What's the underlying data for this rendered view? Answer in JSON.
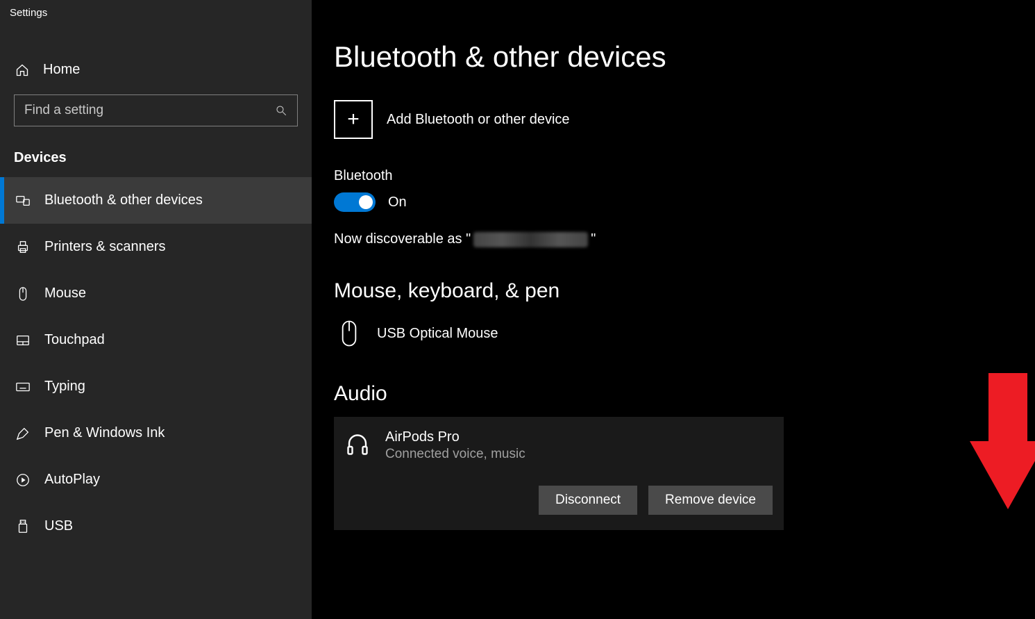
{
  "window_title": "Settings",
  "sidebar": {
    "home_label": "Home",
    "search_placeholder": "Find a setting",
    "section_label": "Devices",
    "items": [
      {
        "label": "Bluetooth & other devices",
        "icon": "bluetooth-devices-icon",
        "selected": true
      },
      {
        "label": "Printers & scanners",
        "icon": "printer-icon",
        "selected": false
      },
      {
        "label": "Mouse",
        "icon": "mouse-icon",
        "selected": false
      },
      {
        "label": "Touchpad",
        "icon": "touchpad-icon",
        "selected": false
      },
      {
        "label": "Typing",
        "icon": "keyboard-icon",
        "selected": false
      },
      {
        "label": "Pen & Windows Ink",
        "icon": "pen-icon",
        "selected": false
      },
      {
        "label": "AutoPlay",
        "icon": "autoplay-icon",
        "selected": false
      },
      {
        "label": "USB",
        "icon": "usb-icon",
        "selected": false
      }
    ]
  },
  "main": {
    "title": "Bluetooth & other devices",
    "add_label": "Add Bluetooth or other device",
    "bluetooth_label": "Bluetooth",
    "toggle_state": "On",
    "discoverable_prefix": "Now discoverable as \"",
    "discoverable_suffix": "\"",
    "section_mouse": "Mouse, keyboard, & pen",
    "mouse_device": "USB Optical Mouse",
    "section_audio": "Audio",
    "audio_device": {
      "name": "AirPods Pro",
      "status": "Connected voice, music",
      "disconnect_label": "Disconnect",
      "remove_label": "Remove device"
    }
  }
}
